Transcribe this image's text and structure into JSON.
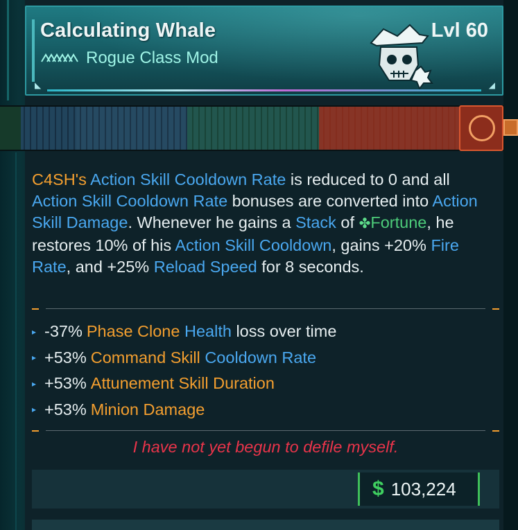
{
  "item": {
    "name": "Calculating Whale",
    "type": "Rogue Class Mod",
    "level": "Lvl 60",
    "rarity_icon": "chevron-stripes-icon",
    "class_icon": "skull-hat-icon"
  },
  "description": {
    "p1_char": "C4SH's",
    "p1_a": "Action Skill Cooldown Rate",
    "p1_b": " is reduced to 0 and all ",
    "p1_c": "Action Skill Cooldown Rate",
    "p1_d": " bonuses are converted into ",
    "p1_e": "Action Skill Damage",
    "p1_f": ". Whenever he gains a ",
    "p1_g": "Stack",
    "p1_h": " of ",
    "p1_i": "Fortune",
    "p1_j": ", he restores 10% of his ",
    "p1_k": "Action Skill Cooldown",
    "p1_l": ", gains +20% ",
    "p1_m": "Fire Rate",
    "p1_n": ", and +25% ",
    "p1_o": "Reload Speed",
    "p1_p": " for 8 seconds."
  },
  "stats": [
    {
      "num": "-37%",
      "orange": "Phase Clone",
      "blue": "Health",
      "rest": "loss over time"
    },
    {
      "num": "+53%",
      "orange": "Command Skill",
      "blue": "Cooldown Rate",
      "rest": ""
    },
    {
      "num": "+53%",
      "orange": "Attunement Skill Duration",
      "blue": "",
      "rest": ""
    },
    {
      "num": "+53%",
      "orange": "Minion Damage",
      "blue": "",
      "rest": ""
    }
  ],
  "flavor": "I have not yet begun to defile myself.",
  "price": {
    "symbol": "$",
    "amount": "103,224"
  },
  "colors": {
    "accent_orange": "#f49f2f",
    "accent_blue": "#4aa8f0",
    "flavor_red": "#e9344a",
    "price_green": "#3fd060"
  }
}
